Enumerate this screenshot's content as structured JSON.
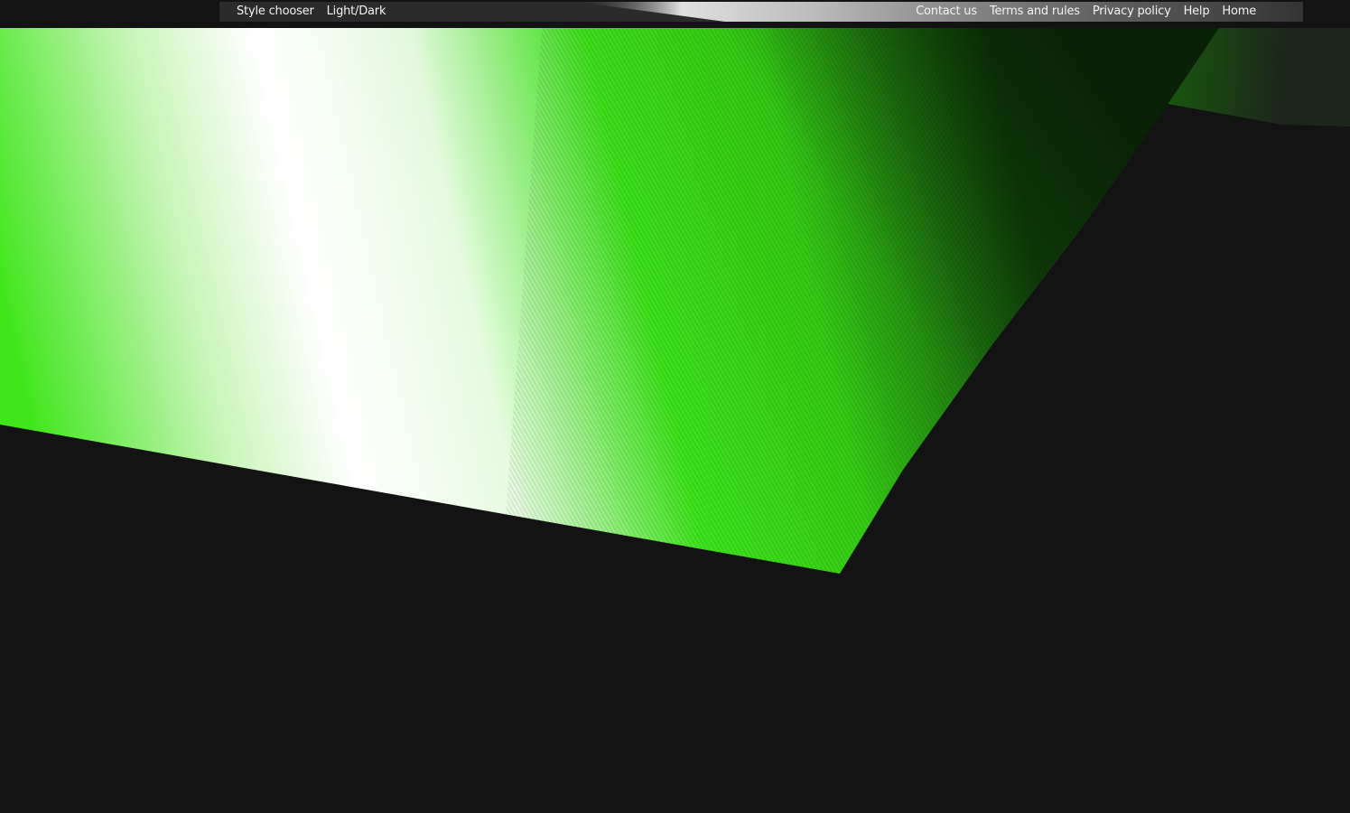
{
  "nav": {
    "left": [
      {
        "label": "Style chooser"
      },
      {
        "label": "Light/Dark"
      }
    ],
    "right": [
      {
        "label": "Contact us"
      },
      {
        "label": "Terms and rules"
      },
      {
        "label": "Privacy policy"
      },
      {
        "label": "Help"
      },
      {
        "label": "Home"
      }
    ]
  },
  "colors": {
    "background": "#131313",
    "accent_green": "#3ee61a",
    "highlight_white": "#ffffff",
    "bar": "#2b2b2b"
  }
}
